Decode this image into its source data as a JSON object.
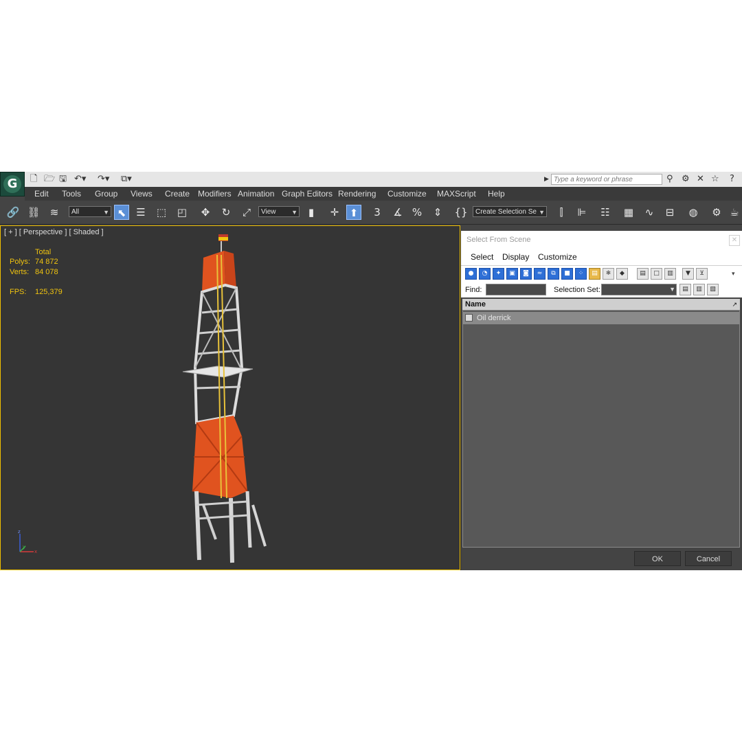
{
  "app": {
    "logo_letter": "G",
    "search_placeholder": "Type a keyword or phrase",
    "menu": [
      "Edit",
      "Tools",
      "Group",
      "Views",
      "Create",
      "Modifiers",
      "Animation",
      "Graph Editors",
      "Rendering",
      "Customize",
      "MAXScript",
      "Help"
    ]
  },
  "toolbar": {
    "selection_filter": "All",
    "ref_coord": "View",
    "snap_3": "3",
    "snap_pct": "%",
    "named_selection": "Create Selection Se"
  },
  "viewport": {
    "label": "[ + ] [ Perspective ] [ Shaded ]",
    "total_label": "Total",
    "polys_label": "Polys:",
    "polys_value": "74 872",
    "verts_label": "Verts:",
    "verts_value": "84 078",
    "fps_label": "FPS:",
    "fps_value": "125,379",
    "axis_z": "z",
    "axis_y": "y",
    "axis_x": "x"
  },
  "dialog": {
    "title": "Select From Scene",
    "menu": [
      "Select",
      "Display",
      "Customize"
    ],
    "find_label": "Find:",
    "selection_set_label": "Selection Set:",
    "column_name": "Name",
    "rows": [
      "Oil derrick"
    ],
    "ok_label": "OK",
    "cancel_label": "Cancel"
  },
  "colors": {
    "accent_blue": "#2e6fd6",
    "viewport_border": "#f0c000",
    "derrick_orange": "#e0531f",
    "stat_yellow": "#f1c40f"
  }
}
